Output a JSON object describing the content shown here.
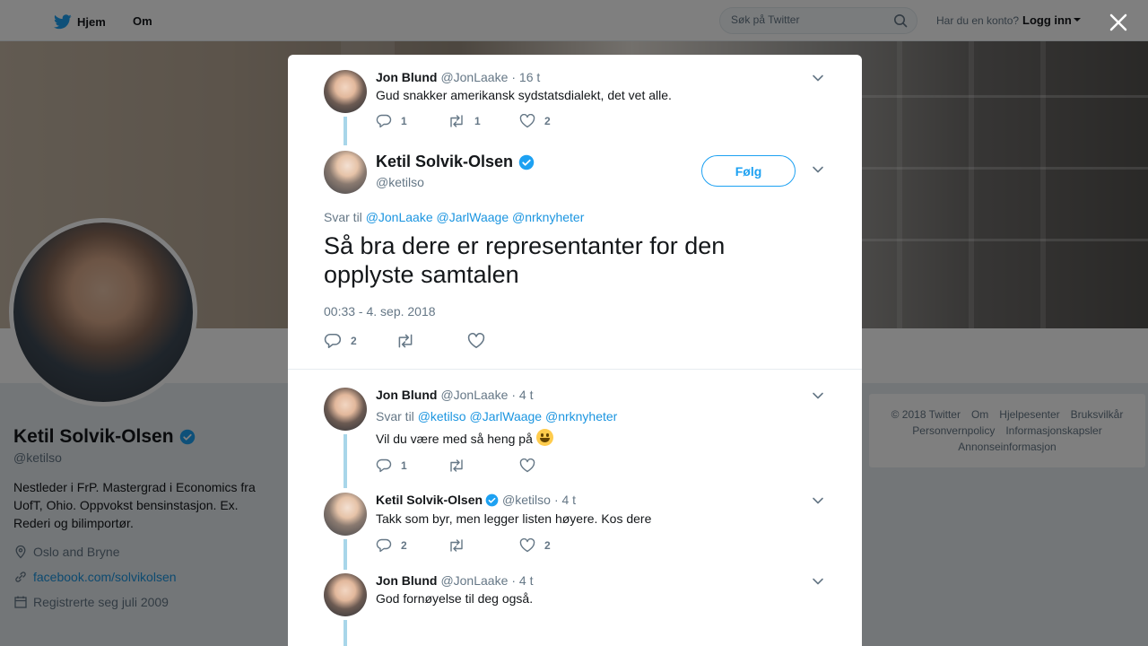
{
  "topbar": {
    "home_label": "Hjem",
    "about_label": "Om",
    "search_placeholder": "Søk på Twitter",
    "login_question": "Har du en konto?",
    "login_label": "Logg inn"
  },
  "profile": {
    "name": "Ketil Solvik-Olsen",
    "handle": "@ketilso",
    "bio": "Nestleder i FrP. Mastergrad i Economics fra UofT, Ohio. Oppvokst bensinstasjon. Ex. Rederi og bilimportør.",
    "location": "Oslo and Bryne",
    "website": "facebook.com/solvikolsen",
    "joined": "Registrerte seg juli 2009"
  },
  "footer": {
    "links": [
      "© 2018 Twitter",
      "Om",
      "Hjelpesenter",
      "Bruksvilkår",
      "Personvernpolicy",
      "Informasjonskapsler",
      "Annonseinformasjon"
    ]
  },
  "modal": {
    "parent_tweet": {
      "name": "Jon Blund",
      "handle": "@JonLaake",
      "time": "· 16 t",
      "text": "Gud snakker amerikansk sydstatsdialekt, det vet alle.",
      "replies": "1",
      "retweets": "1",
      "likes": "2"
    },
    "main_tweet": {
      "name": "Ketil Solvik-Olsen",
      "handle": "@ketilso",
      "follow_label": "Følg",
      "reply_prefix": "Svar til",
      "reply_to": [
        "@JonLaake",
        "@JarlWaage",
        "@nrknyheter"
      ],
      "text": "Så bra dere er representanter for den opplyste samtalen",
      "timestamp": "00:33 - 4. sep. 2018",
      "replies": "2"
    },
    "replies": [
      {
        "name": "Jon Blund",
        "handle": "@JonLaake",
        "time": "· 4 t",
        "reply_prefix": "Svar til",
        "reply_to": [
          "@ketilso",
          "@JarlWaage",
          "@nrknyheter"
        ],
        "text": "Vil du være med så heng på",
        "replies": "1",
        "retweets": "",
        "likes": ""
      },
      {
        "name": "Ketil Solvik-Olsen",
        "handle": "@ketilso",
        "time": "· 4 t",
        "text": "Takk som byr, men legger listen høyere. Kos dere",
        "replies": "2",
        "retweets": "",
        "likes": "2"
      },
      {
        "name": "Jon Blund",
        "handle": "@JonLaake",
        "time": "· 4 t",
        "text": "God fornøyelse til deg også."
      }
    ]
  },
  "colors": {
    "accent": "#1da1f2",
    "link": "#1b95e0",
    "thread_line": "#a8d6e9",
    "muted": "#657786"
  }
}
